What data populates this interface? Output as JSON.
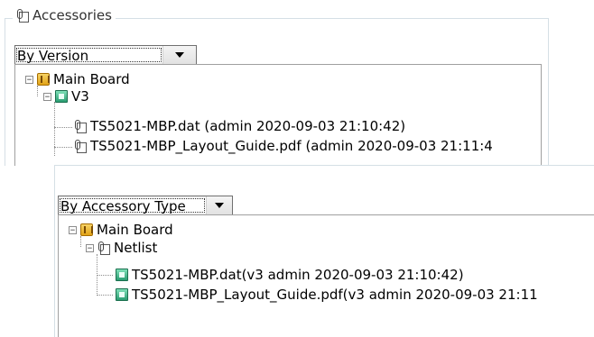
{
  "groupbox": {
    "title": "Accessories",
    "icon": "paperclip-icon"
  },
  "by_version": {
    "selected": "By Version",
    "tree": {
      "root": "Main Board",
      "version": "V3",
      "files": [
        "TS5021-MBP.dat (admin 2020-09-03 21:10:42)",
        "TS5021-MBP_Layout_Guide.pdf (admin 2020-09-03 21:11:4"
      ]
    }
  },
  "by_type": {
    "selected": "By Accessory Type",
    "tree": {
      "root": "Main Board",
      "type": "Netlist",
      "files": [
        "TS5021-MBP.dat(v3 admin 2020-09-03 21:10:42)",
        "TS5021-MBP_Layout_Guide.pdf(v3 admin 2020-09-03 21:11"
      ]
    }
  },
  "tree_expander": "−"
}
